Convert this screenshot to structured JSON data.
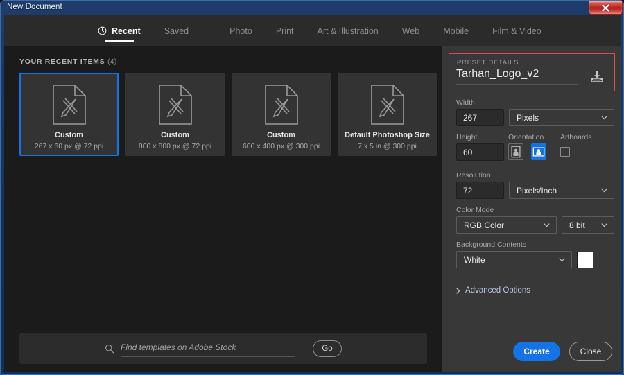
{
  "window": {
    "title": "New Document",
    "close_label": "✕"
  },
  "tabs": [
    {
      "label": "Recent",
      "icon": "clock-icon",
      "active": true
    },
    {
      "label": "Saved",
      "active": false
    },
    {
      "label": "Photo",
      "active": false
    },
    {
      "label": "Print",
      "active": false
    },
    {
      "label": "Art & Illustration",
      "active": false
    },
    {
      "label": "Web",
      "active": false
    },
    {
      "label": "Mobile",
      "active": false
    },
    {
      "label": "Film & Video",
      "active": false
    }
  ],
  "recent": {
    "section_title": "YOUR RECENT ITEMS",
    "count": "(4)",
    "items": [
      {
        "name": "Custom",
        "meta": "267 x 60 px @ 72 ppi",
        "selected": true
      },
      {
        "name": "Custom",
        "meta": "800 x 800 px @ 72 ppi",
        "selected": false
      },
      {
        "name": "Custom",
        "meta": "600 x 400 px @ 300 ppi",
        "selected": false
      },
      {
        "name": "Default Photoshop Size",
        "meta": "7 x 5 in @ 300 ppi",
        "selected": false
      }
    ]
  },
  "search": {
    "placeholder": "Find templates on Adobe Stock",
    "go_label": "Go"
  },
  "preset": {
    "section_label": "PRESET DETAILS",
    "name_value": "Tarhan_Logo_v2",
    "width_label": "Width",
    "width_value": "267",
    "width_unit": "Pixels",
    "height_label": "Height",
    "height_value": "60",
    "orientation_label": "Orientation",
    "orientation_selected": "landscape",
    "artboards_label": "Artboards",
    "artboards_checked": false,
    "resolution_label": "Resolution",
    "resolution_value": "72",
    "resolution_unit": "Pixels/Inch",
    "color_mode_label": "Color Mode",
    "color_mode_value": "RGB Color",
    "bit_depth_value": "8 bit",
    "background_label": "Background Contents",
    "background_value": "White",
    "background_swatch": "#ffffff",
    "advanced_label": "Advanced Options"
  },
  "actions": {
    "create_label": "Create",
    "close_label": "Close"
  },
  "colors": {
    "accent": "#1473e6",
    "highlight_outline": "#d05050",
    "panel_bg": "#383838",
    "content_bg": "#1b1b1b",
    "card_bg": "#333333"
  }
}
